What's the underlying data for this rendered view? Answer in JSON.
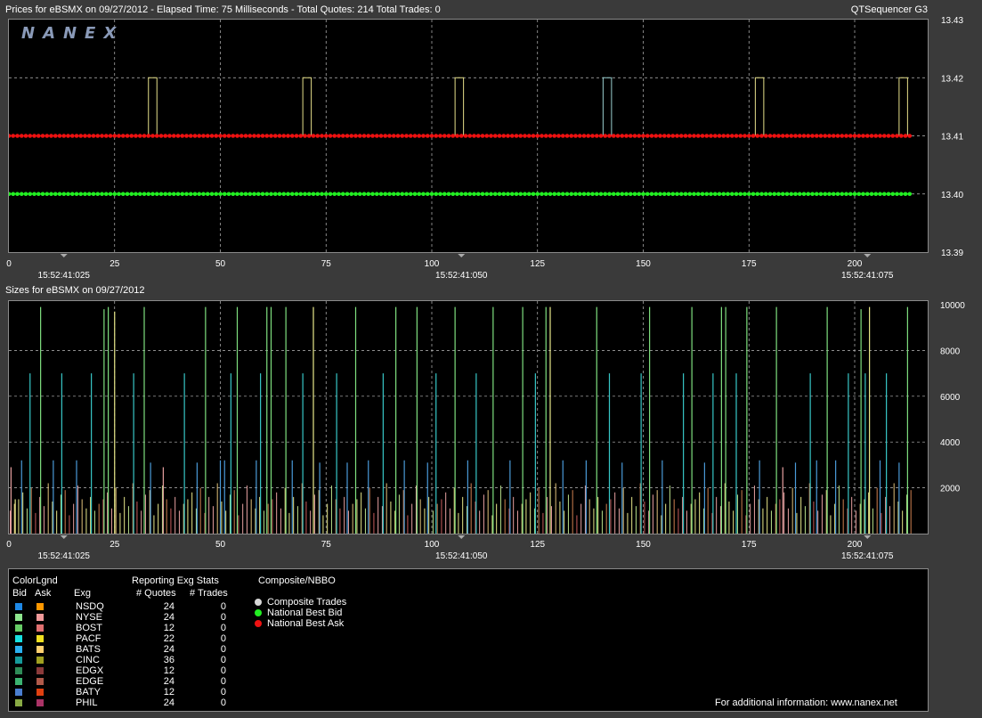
{
  "header": {
    "prices_title": "Prices for  eBSMX  on  09/27/2012  -  Elapsed Time: 75 Milliseconds  -  Total Quotes: 214  Total Trades: 0",
    "app_name": "QTSequencer G3",
    "sizes_title": "Sizes for  eBSMX  on  09/27/2012"
  },
  "logo": "NANEX",
  "colors": {
    "background": "#3a3a3a",
    "panel": "#000000",
    "best_bid": "#22ee22",
    "best_ask": "#ee1111",
    "grid": "#bdbdbd"
  },
  "chart_data": [
    {
      "type": "line",
      "title": "Prices for  eBSMX  on  09/27/2012",
      "x_ticks": [
        "0",
        "25",
        "50",
        "75",
        "100",
        "125",
        "150",
        "175",
        "200"
      ],
      "time_labels": [
        {
          "x": 13,
          "label": "15:52:41:025"
        },
        {
          "x": 107,
          "label": "15:52:41:050"
        },
        {
          "x": 203,
          "label": "15:52:41:075"
        }
      ],
      "y_ticks": [
        "13.43",
        "13.42",
        "13.41",
        "13.40",
        "13.39"
      ],
      "xlim": [
        0,
        214
      ],
      "ylim": [
        13.39,
        13.43
      ],
      "grid": true,
      "series": [
        {
          "name": "National Best Ask",
          "color": "#ee1111",
          "constant": 13.41,
          "count": 214
        },
        {
          "name": "National Best Bid",
          "color": "#22ee22",
          "constant": 13.4,
          "count": 214
        }
      ],
      "ask_spikes": [
        {
          "x": 33,
          "color": "#e6e08a"
        },
        {
          "x": 35,
          "color": "#9ad0d0"
        },
        {
          "x": 69.5,
          "color": "#e6e08a"
        },
        {
          "x": 71.5,
          "color": "#e6e08a"
        },
        {
          "x": 105.5,
          "color": "#e6e08a"
        },
        {
          "x": 107.5,
          "color": "#e6e08a"
        },
        {
          "x": 140.5,
          "color": "#9ad0d0"
        },
        {
          "x": 142.5,
          "color": "#9ad0d0"
        },
        {
          "x": 176.5,
          "color": "#e6e08a"
        },
        {
          "x": 178.5,
          "color": "#e6e08a"
        },
        {
          "x": 210.5,
          "color": "#e6e08a"
        },
        {
          "x": 212.5,
          "color": "#9ad0d0"
        }
      ]
    },
    {
      "type": "bar",
      "title": "Sizes for  eBSMX  on  09/27/2012",
      "x_ticks": [
        "0",
        "25",
        "50",
        "75",
        "100",
        "125",
        "150",
        "175",
        "200"
      ],
      "time_labels": [
        {
          "x": 13,
          "label": "15:52:41:025"
        },
        {
          "x": 107,
          "label": "15:52:41:050"
        },
        {
          "x": 203,
          "label": "15:52:41:075"
        }
      ],
      "y_ticks": [
        "10000",
        "8000",
        "6000",
        "4000",
        "2000"
      ],
      "xlim": [
        0,
        214
      ],
      "ylim": [
        0,
        10000
      ],
      "grid": true,
      "bars": [
        {
          "x": 0.5,
          "value": 2900,
          "color": "#e7a0a0"
        },
        {
          "x": 1.5,
          "value": 1500,
          "color": "#e9e98a"
        },
        {
          "x": 3,
          "value": 3200,
          "color": "#4a9ad8"
        },
        {
          "x": 5,
          "value": 7000,
          "color": "#37c7c7"
        },
        {
          "x": 7.5,
          "value": 9900,
          "color": "#7fe07f"
        },
        {
          "x": 10.5,
          "value": 3200,
          "color": "#4a9ad8"
        },
        {
          "x": 12.5,
          "value": 7000,
          "color": "#37c7c7"
        },
        {
          "x": 16,
          "value": 3200,
          "color": "#4a9ad8"
        },
        {
          "x": 19.5,
          "value": 7000,
          "color": "#37c7c7"
        },
        {
          "x": 22.5,
          "value": 9800,
          "color": "#7fe07f"
        },
        {
          "x": 23.5,
          "value": 9900,
          "color": "#7fe07f"
        },
        {
          "x": 25,
          "value": 9700,
          "color": "#e9e98a"
        },
        {
          "x": 29.5,
          "value": 7000,
          "color": "#37c7c7"
        },
        {
          "x": 32,
          "value": 9900,
          "color": "#7fe07f"
        },
        {
          "x": 33.5,
          "value": 3100,
          "color": "#4a9ad8"
        },
        {
          "x": 36.5,
          "value": 2900,
          "color": "#e7a0a0"
        },
        {
          "x": 41.5,
          "value": 7000,
          "color": "#37c7c7"
        },
        {
          "x": 44.5,
          "value": 3100,
          "color": "#4a9ad8"
        },
        {
          "x": 46.5,
          "value": 9900,
          "color": "#7fe07f"
        },
        {
          "x": 50,
          "value": 3200,
          "color": "#4a9ad8"
        },
        {
          "x": 51,
          "value": 3200,
          "color": "#4a9ad8"
        },
        {
          "x": 52.5,
          "value": 7000,
          "color": "#37c7c7"
        },
        {
          "x": 54,
          "value": 9900,
          "color": "#7fe07f"
        },
        {
          "x": 58.5,
          "value": 3200,
          "color": "#4a9ad8"
        },
        {
          "x": 59.5,
          "value": 7000,
          "color": "#37c7c7"
        },
        {
          "x": 61,
          "value": 9900,
          "color": "#7fe07f"
        },
        {
          "x": 62,
          "value": 9900,
          "color": "#7fe07f"
        },
        {
          "x": 65.5,
          "value": 9900,
          "color": "#7fe07f"
        },
        {
          "x": 67,
          "value": 3200,
          "color": "#4a9ad8"
        },
        {
          "x": 69.5,
          "value": 7000,
          "color": "#37c7c7"
        },
        {
          "x": 72,
          "value": 9900,
          "color": "#e9e98a"
        },
        {
          "x": 73.5,
          "value": 3100,
          "color": "#4a9ad8"
        },
        {
          "x": 77.5,
          "value": 7000,
          "color": "#37c7c7"
        },
        {
          "x": 80,
          "value": 3100,
          "color": "#4a9ad8"
        },
        {
          "x": 82,
          "value": 9900,
          "color": "#7fe07f"
        },
        {
          "x": 85,
          "value": 3200,
          "color": "#4a9ad8"
        },
        {
          "x": 88.5,
          "value": 7000,
          "color": "#37c7c7"
        },
        {
          "x": 91.5,
          "value": 9900,
          "color": "#7fe07f"
        },
        {
          "x": 93.5,
          "value": 3200,
          "color": "#4a9ad8"
        },
        {
          "x": 96.5,
          "value": 9900,
          "color": "#7fe07f"
        },
        {
          "x": 99,
          "value": 3100,
          "color": "#4a9ad8"
        },
        {
          "x": 101,
          "value": 7000,
          "color": "#37c7c7"
        },
        {
          "x": 105.5,
          "value": 9900,
          "color": "#7fe07f"
        },
        {
          "x": 108.5,
          "value": 3200,
          "color": "#4a9ad8"
        },
        {
          "x": 110.5,
          "value": 7000,
          "color": "#37c7c7"
        },
        {
          "x": 114.5,
          "value": 9900,
          "color": "#7fe07f"
        },
        {
          "x": 118.5,
          "value": 3200,
          "color": "#4a9ad8"
        },
        {
          "x": 121.5,
          "value": 9900,
          "color": "#7fe07f"
        },
        {
          "x": 124.5,
          "value": 7000,
          "color": "#37c7c7"
        },
        {
          "x": 127,
          "value": 9900,
          "color": "#7fe07f"
        },
        {
          "x": 128,
          "value": 9900,
          "color": "#e9e98a"
        },
        {
          "x": 131,
          "value": 3200,
          "color": "#4a9ad8"
        },
        {
          "x": 136.5,
          "value": 3200,
          "color": "#4a9ad8"
        },
        {
          "x": 139,
          "value": 9900,
          "color": "#7fe07f"
        },
        {
          "x": 142,
          "value": 7000,
          "color": "#37c7c7"
        },
        {
          "x": 145,
          "value": 3100,
          "color": "#4a9ad8"
        },
        {
          "x": 149.5,
          "value": 7000,
          "color": "#37c7c7"
        },
        {
          "x": 151.5,
          "value": 9900,
          "color": "#7fe07f"
        },
        {
          "x": 154.5,
          "value": 3200,
          "color": "#4a9ad8"
        },
        {
          "x": 159.5,
          "value": 7000,
          "color": "#37c7c7"
        },
        {
          "x": 161.5,
          "value": 9900,
          "color": "#7fe07f"
        },
        {
          "x": 164.5,
          "value": 3100,
          "color": "#4a9ad8"
        },
        {
          "x": 166.5,
          "value": 7000,
          "color": "#37c7c7"
        },
        {
          "x": 168.5,
          "value": 9900,
          "color": "#7fe07f"
        },
        {
          "x": 169.5,
          "value": 9900,
          "color": "#7fe07f"
        },
        {
          "x": 172,
          "value": 7000,
          "color": "#37c7c7"
        },
        {
          "x": 174.5,
          "value": 9900,
          "color": "#7fe07f"
        },
        {
          "x": 177.5,
          "value": 3200,
          "color": "#4a9ad8"
        },
        {
          "x": 181.5,
          "value": 9900,
          "color": "#7fe07f"
        },
        {
          "x": 183,
          "value": 2900,
          "color": "#e7a0a0"
        },
        {
          "x": 186,
          "value": 3100,
          "color": "#4a9ad8"
        },
        {
          "x": 189.5,
          "value": 7000,
          "color": "#37c7c7"
        },
        {
          "x": 191,
          "value": 3200,
          "color": "#4a9ad8"
        },
        {
          "x": 193.5,
          "value": 9900,
          "color": "#7fe07f"
        },
        {
          "x": 195.5,
          "value": 3200,
          "color": "#4a9ad8"
        },
        {
          "x": 198.5,
          "value": 7000,
          "color": "#37c7c7"
        },
        {
          "x": 201.5,
          "value": 9800,
          "color": "#7fe07f"
        },
        {
          "x": 202.5,
          "value": 7000,
          "color": "#37c7c7"
        },
        {
          "x": 203.5,
          "value": 9900,
          "color": "#e9e98a"
        },
        {
          "x": 206,
          "value": 3200,
          "color": "#4a9ad8"
        },
        {
          "x": 207.5,
          "value": 7000,
          "color": "#37c7c7"
        },
        {
          "x": 210.5,
          "value": 3100,
          "color": "#4a9ad8"
        },
        {
          "x": 212.5,
          "value": 9900,
          "color": "#7fe07f"
        }
      ],
      "small_bars": {
        "sizes": [
          1000,
          1300,
          1500,
          1800,
          1100,
          2000,
          900,
          1600,
          1200,
          2200,
          1400,
          1000,
          1700,
          1900,
          800,
          1300,
          2100,
          1500,
          1100,
          1600
        ],
        "colors": [
          "#e7a0a0",
          "#e9e98a",
          "#c85c5c",
          "#e1c27a",
          "#b8e08a",
          "#e7a0a0",
          "#e9e98a",
          "#d08050"
        ]
      }
    }
  ],
  "legend": {
    "color_legend_title": "ColorLgnd",
    "bid_header": "Bid",
    "ask_header": "Ask",
    "exch_header": "Exg",
    "stats_title": "Reporting Exg Stats",
    "quotes_header": "# Quotes",
    "trades_header": "# Trades",
    "composite_title": "Composite/NBBO",
    "rows": [
      {
        "exchange": "NSDQ",
        "quotes": "24",
        "trades": "0",
        "bid_color": "#1e88e5",
        "ask_color": "#ff9800"
      },
      {
        "exchange": "NYSE",
        "quotes": "24",
        "trades": "0",
        "bid_color": "#8ee68e",
        "ask_color": "#f19a9a"
      },
      {
        "exchange": "BOST",
        "quotes": "12",
        "trades": "0",
        "bid_color": "#66cc66",
        "ask_color": "#e07070"
      },
      {
        "exchange": "PACF",
        "quotes": "22",
        "trades": "0",
        "bid_color": "#18e0e0",
        "ask_color": "#f0e020"
      },
      {
        "exchange": "BATS",
        "quotes": "24",
        "trades": "0",
        "bid_color": "#2ab0f0",
        "ask_color": "#ffd070"
      },
      {
        "exchange": "CINC",
        "quotes": "36",
        "trades": "0",
        "bid_color": "#159a9a",
        "ask_color": "#a0a020"
      },
      {
        "exchange": "EDGX",
        "quotes": "12",
        "trades": "0",
        "bid_color": "#2e8b57",
        "ask_color": "#8b3a3a"
      },
      {
        "exchange": "EDGE",
        "quotes": "24",
        "trades": "0",
        "bid_color": "#3cb371",
        "ask_color": "#b05a4a"
      },
      {
        "exchange": "BATY",
        "quotes": "12",
        "trades": "0",
        "bid_color": "#4a7ed0",
        "ask_color": "#e04010"
      },
      {
        "exchange": "PHIL",
        "quotes": "24",
        "trades": "0",
        "bid_color": "#88aa44",
        "ask_color": "#aa3366"
      }
    ],
    "composite_items": [
      {
        "label": "Composite Trades",
        "color": "#d8d8d8"
      },
      {
        "label": "National Best Bid",
        "color": "#22ee22"
      },
      {
        "label": "National Best Ask",
        "color": "#ee1111"
      }
    ],
    "footer": "For additional information:  www.nanex.net"
  }
}
